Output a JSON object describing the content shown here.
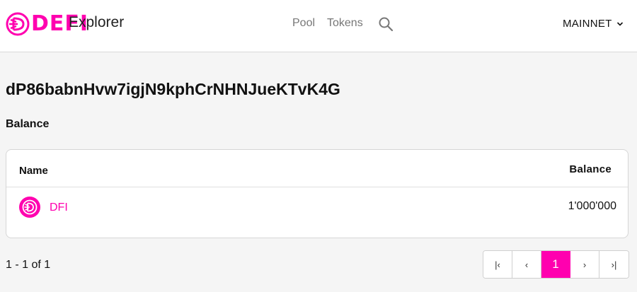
{
  "header": {
    "logo_text": "DEFI",
    "app_title": "Explorer",
    "nav": [
      {
        "label": "Pool"
      },
      {
        "label": "Tokens"
      }
    ],
    "network": "MAINNET",
    "accent_color": "#ff00af"
  },
  "address": "dP86babnHvw7igjN9kphCrNHNJueKTvK4G",
  "balance_section": {
    "title": "Balance",
    "columns": {
      "name": "Name",
      "balance": "Balance"
    },
    "rows": [
      {
        "name": "DFI",
        "balance": "1'000'000",
        "icon": "defi-token-icon"
      }
    ]
  },
  "pagination": {
    "range_text": "1 - 1 of 1",
    "first": "|‹",
    "prev": "‹",
    "current": "1",
    "next": "›",
    "last": "›|"
  }
}
